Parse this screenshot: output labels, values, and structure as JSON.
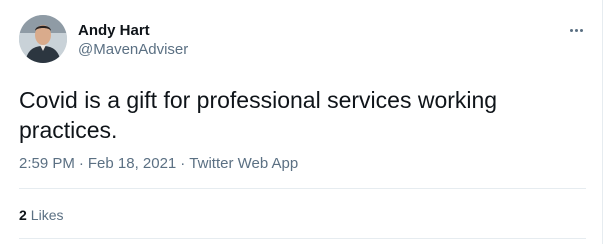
{
  "author": {
    "name": "Andy Hart",
    "handle": "@MavenAdviser"
  },
  "tweet": {
    "text": "Covid is a gift for professional services working practices.",
    "time": "2:59 PM",
    "date": "Feb 18, 2021",
    "source": "Twitter Web App",
    "separator": "·"
  },
  "stats": {
    "likes_count": "2",
    "likes_label": "Likes"
  },
  "icons": {
    "more": "more-horizontal-icon"
  },
  "colors": {
    "text_primary": "#0f1419",
    "text_secondary": "#5b7083",
    "divider": "#e6ecf0"
  }
}
